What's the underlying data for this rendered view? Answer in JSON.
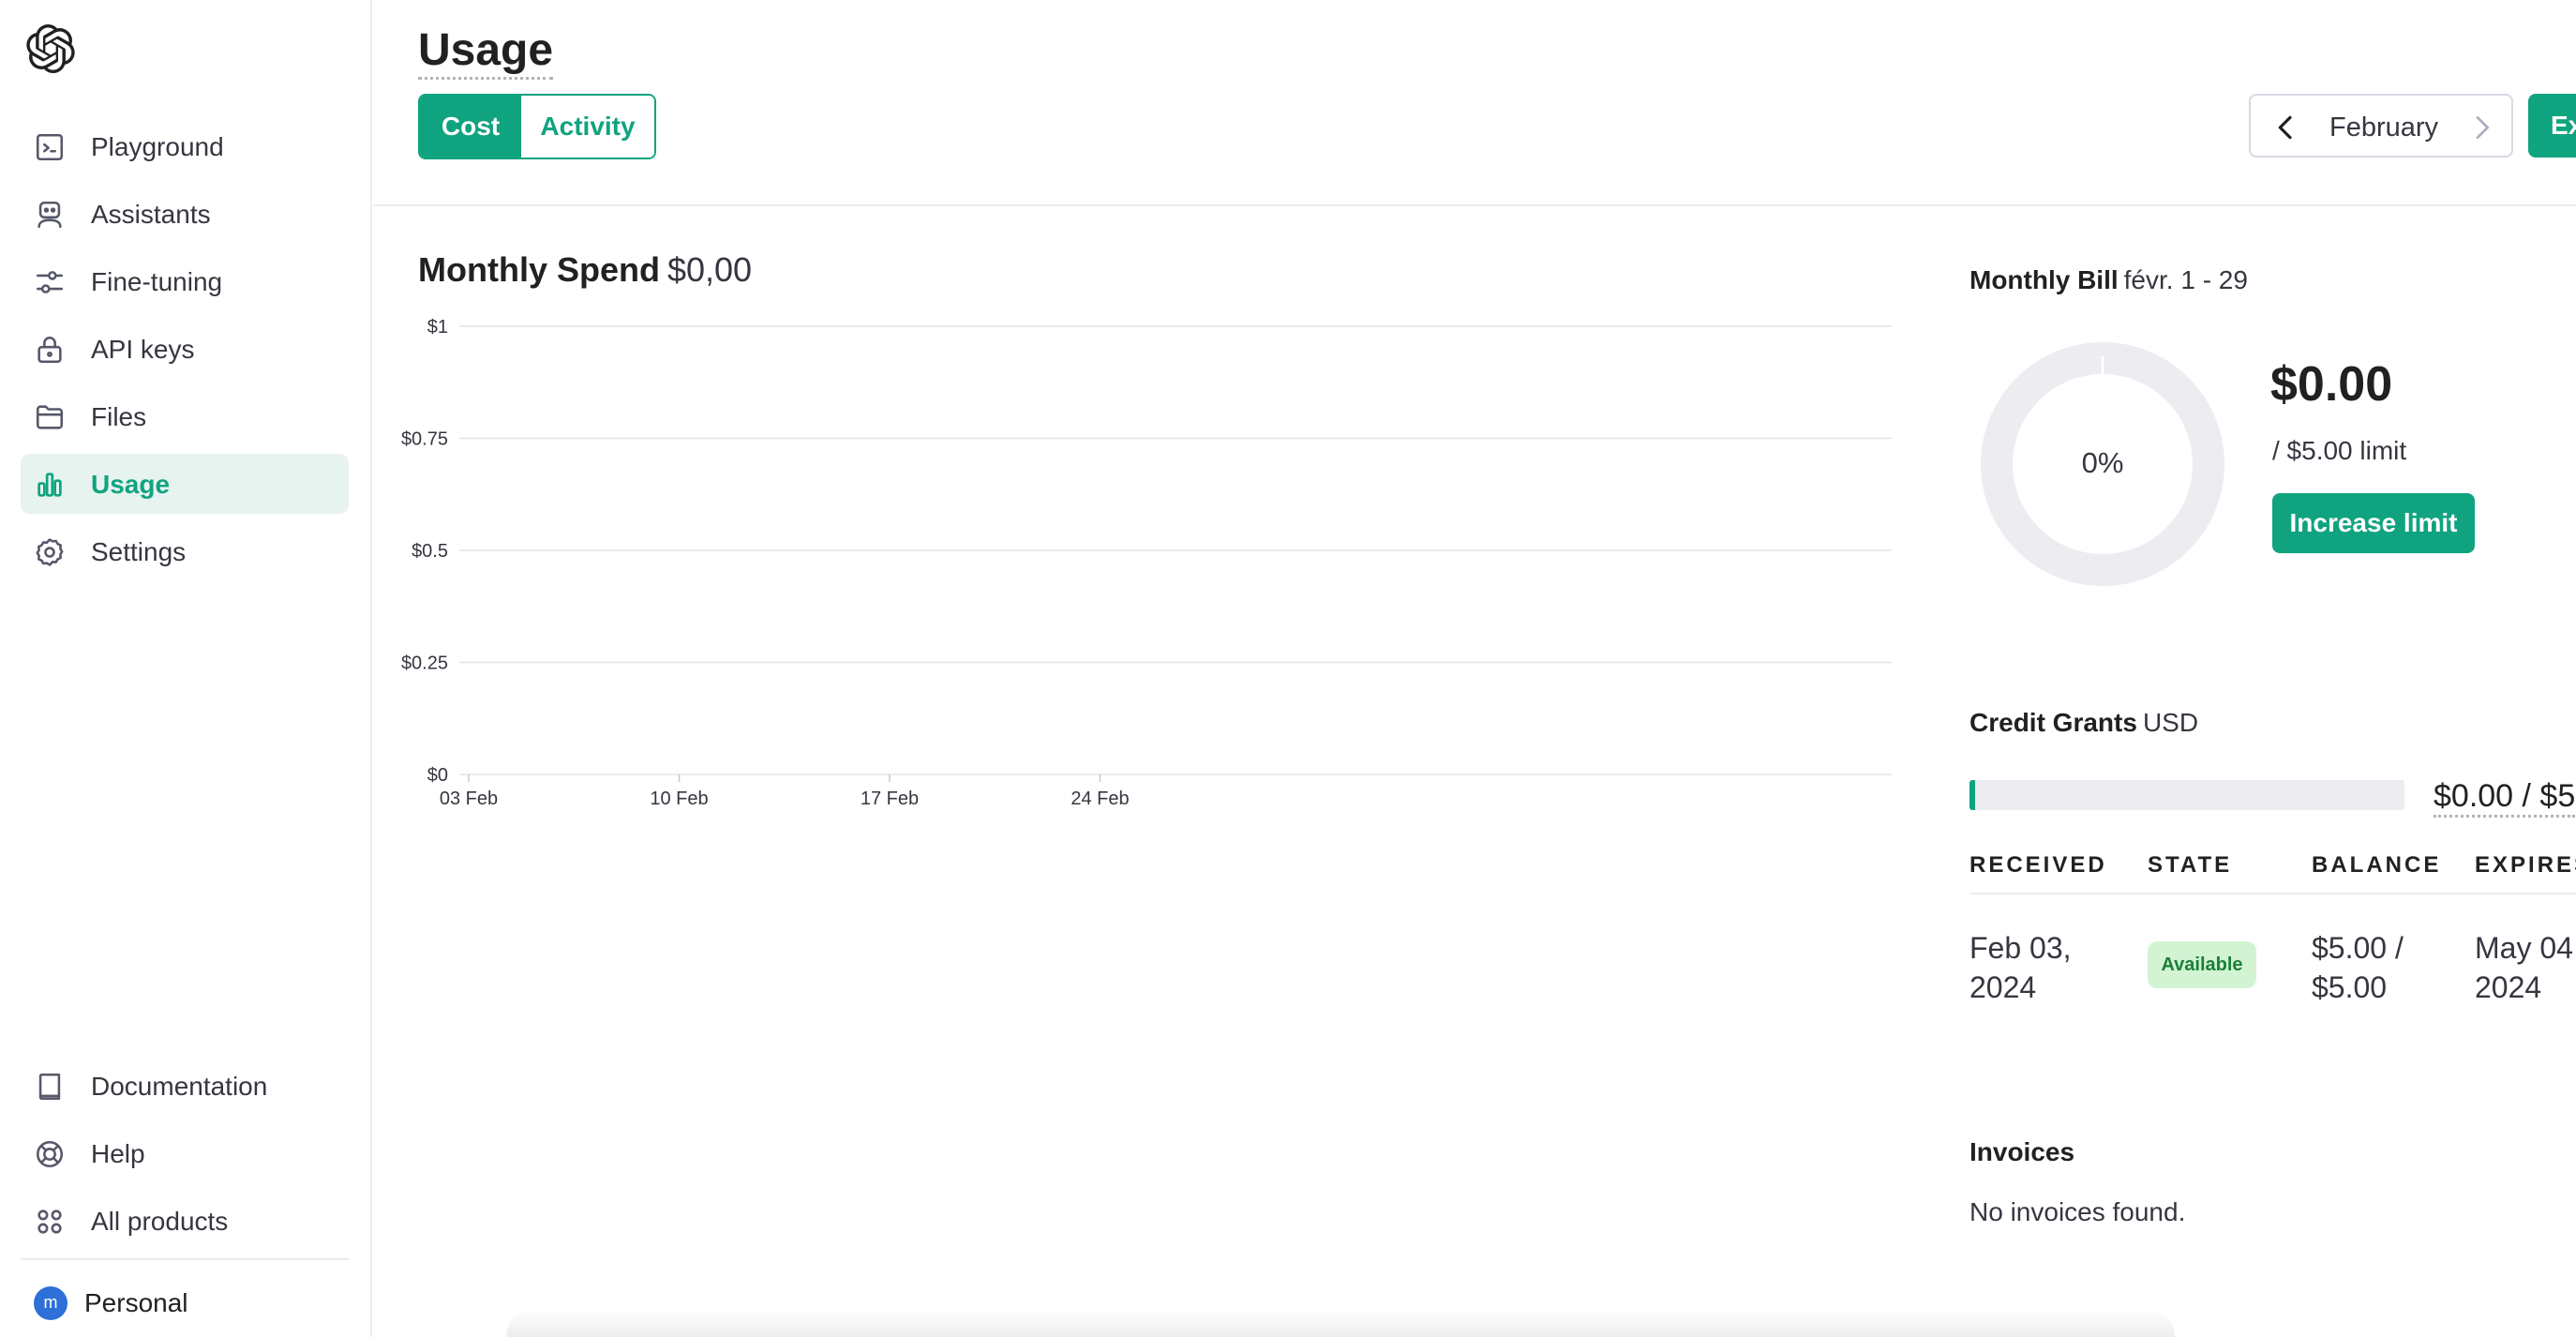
{
  "sidebar": {
    "items": [
      {
        "label": "Playground",
        "icon": "terminal-icon",
        "active": false
      },
      {
        "label": "Assistants",
        "icon": "robot-icon",
        "active": false
      },
      {
        "label": "Fine-tuning",
        "icon": "sliders-icon",
        "active": false
      },
      {
        "label": "API keys",
        "icon": "lock-icon",
        "active": false
      },
      {
        "label": "Files",
        "icon": "folder-icon",
        "active": false
      },
      {
        "label": "Usage",
        "icon": "bar-chart-icon",
        "active": true
      },
      {
        "label": "Settings",
        "icon": "gear-icon",
        "active": false
      }
    ],
    "bottom_items": [
      {
        "label": "Documentation",
        "icon": "book-icon"
      },
      {
        "label": "Help",
        "icon": "lifebuoy-icon"
      },
      {
        "label": "All products",
        "icon": "grid-icon"
      }
    ],
    "account": {
      "avatar_initial": "m",
      "label": "Personal",
      "avatar_color": "#2e6fd8"
    }
  },
  "header": {
    "title": "Usage",
    "tabs": [
      {
        "label": "Cost",
        "active": true
      },
      {
        "label": "Activity",
        "active": false
      }
    ],
    "month": "February",
    "export_label": "Ex"
  },
  "spend": {
    "title": "Monthly Spend",
    "value": "$0,00"
  },
  "chart_data": {
    "type": "bar",
    "title": "Monthly Spend",
    "xlabel": "",
    "ylabel": "",
    "x_tick_labels": [
      "03 Feb",
      "10 Feb",
      "17 Feb",
      "24 Feb"
    ],
    "y_tick_labels": [
      "$0",
      "$0.25",
      "$0.5",
      "$0.75",
      "$1"
    ],
    "y_ticks": [
      0,
      0.25,
      0.5,
      0.75,
      1
    ],
    "ylim": [
      0,
      1
    ],
    "series": [
      {
        "values": []
      }
    ],
    "grid": true
  },
  "bill": {
    "title": "Monthly Bill",
    "range": "févr. 1 - 29",
    "percent_label": "0%",
    "percent": 0,
    "amount": "$0.00",
    "limit": "/ $5.00 limit",
    "increase_label": "Increase limit"
  },
  "grants": {
    "title": "Credit Grants",
    "currency": "USD",
    "used_fraction": 0,
    "amount": "$0.00 / $5",
    "columns": [
      "RECEIVED",
      "STATE",
      "BALANCE",
      "EXPIRES"
    ],
    "rows": [
      {
        "received": "Feb 03, 2024",
        "state": "Available",
        "balance": "$5.00 / $5.00",
        "expires": "May 04, 2024"
      }
    ]
  },
  "invoices": {
    "title": "Invoices",
    "empty": "No invoices found."
  },
  "colors": {
    "accent": "#10a37f",
    "accent_light": "#e6f3ef",
    "badge_bg": "#d2f4d3",
    "badge_text": "#1a7f37",
    "track": "#ececf1"
  }
}
